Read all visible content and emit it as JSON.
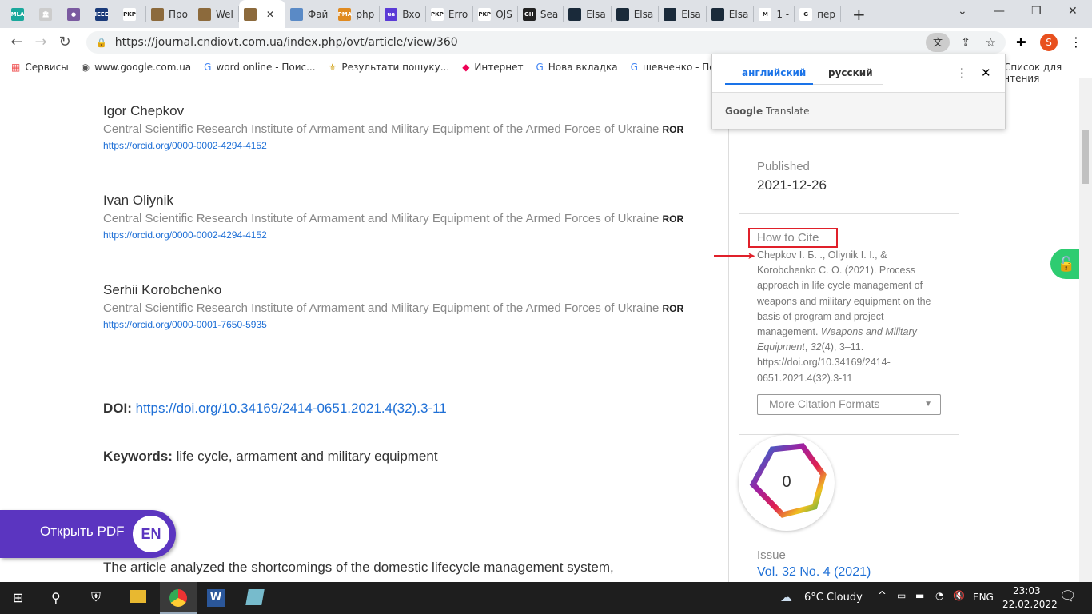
{
  "tabs": [
    {
      "icon": "MLA",
      "label": "",
      "color": "#1aa89c"
    },
    {
      "icon": "🏛",
      "label": "",
      "color": "#ccc"
    },
    {
      "icon": "●",
      "label": "",
      "color": "#7a5aa0"
    },
    {
      "icon": "IEEE",
      "label": "",
      "color": "#1a3a7a"
    },
    {
      "icon": "PKP",
      "label": "",
      "color": "#fff"
    },
    {
      "icon": "",
      "label": "Про",
      "color": "#8c6a3c"
    },
    {
      "icon": "",
      "label": "Wel",
      "color": "#8c6a3c"
    },
    {
      "icon": "",
      "label": "",
      "color": "#8c6a3c",
      "active": true
    },
    {
      "icon": "",
      "label": "Фай",
      "color": "#5a8ac6"
    },
    {
      "icon": "PMA",
      "label": "php",
      "color": "#e08a20"
    },
    {
      "icon": "ua",
      "label": "Вхо",
      "color": "#5a3ad6"
    },
    {
      "icon": "PKP",
      "label": "Erro",
      "color": "#fff"
    },
    {
      "icon": "PKP",
      "label": "OJS",
      "color": "#fff"
    },
    {
      "icon": "GH",
      "label": "Sea",
      "color": "#222"
    },
    {
      "icon": "",
      "label": "Elsa",
      "color": "#1a2a3a"
    },
    {
      "icon": "",
      "label": "Elsa",
      "color": "#1a2a3a"
    },
    {
      "icon": "",
      "label": "Elsa",
      "color": "#1a2a3a"
    },
    {
      "icon": "",
      "label": "Elsa",
      "color": "#1a2a3a"
    },
    {
      "icon": "M",
      "label": "1 -",
      "color": "#fff"
    },
    {
      "icon": "G",
      "label": "пер",
      "color": "#fff"
    }
  ],
  "address": {
    "url": "https://journal.cndiovt.com.ua/index.php/ovt/article/view/360"
  },
  "profile_initial": "S",
  "bookmarks": [
    "Сервисы",
    "www.google.com.ua",
    "word online - Поис...",
    "Результати пошуку...",
    "Интернет",
    "Нова вкладка",
    "шевченко - Пошук"
  ],
  "reading_list": "Список для чтения",
  "translate": {
    "tab_source": "английский",
    "tab_target": "русский",
    "brand": "Google",
    "product": "Translate"
  },
  "authors": [
    {
      "name": "Igor Chepkov",
      "affiliation": "Central Scientific Research Institute of Armament and Military Equipment of the Armed Forces of Ukraine",
      "ror": "ROR",
      "orcid": "https://orcid.org/0000-0002-4294-4152"
    },
    {
      "name": "Ivan Oliynik",
      "affiliation": "Central Scientific Research Institute of Armament and Military Equipment of the Armed Forces of Ukraine",
      "ror": "ROR",
      "orcid": "https://orcid.org/0000-0002-4294-4152"
    },
    {
      "name": "Serhii Korobchenko",
      "affiliation": "Central Scientific Research Institute of Armament and Military Equipment of the Armed Forces of Ukraine",
      "ror": "ROR",
      "orcid": "https://orcid.org/0000-0001-7650-5935"
    }
  ],
  "doi": {
    "label": "DOI:",
    "link": "https://doi.org/10.34169/2414-0651.2021.4(32).3-11"
  },
  "keywords": {
    "label": "Keywords:",
    "value": "life cycle, armament and military equipment"
  },
  "abstract_start": "The article analyzed the shortcomings of the domestic lifecycle management system,",
  "pdf_button": {
    "label": "Открыть PDF",
    "badge": "EN",
    "color": "#5b35c0"
  },
  "sidebar": {
    "published_label": "Published",
    "published_date": "2021-12-26",
    "cite_label": "How to Cite",
    "citation_plain": "Chepkov I. Б. ., Oliynik I. I., & Korobchenko C. O. (2021). Process approach in life cycle management of weapons and military equipment on the basis of program and project management. ",
    "citation_journal": "Weapons and Military Equipment",
    "citation_vol": "32",
    "citation_rest": "(4), 3–11. https://doi.org/10.34169/2414-0651.2021.4(32).3-11",
    "citation_formats": "More Citation Formats",
    "dimensions_count": "0",
    "issue_label": "Issue",
    "issue_value": "Vol. 32 No. 4 (2021)"
  },
  "taskbar": {
    "weather": "6°C  Cloudy",
    "lang": "ENG",
    "time": "23:03",
    "date": "22.02.2022"
  }
}
